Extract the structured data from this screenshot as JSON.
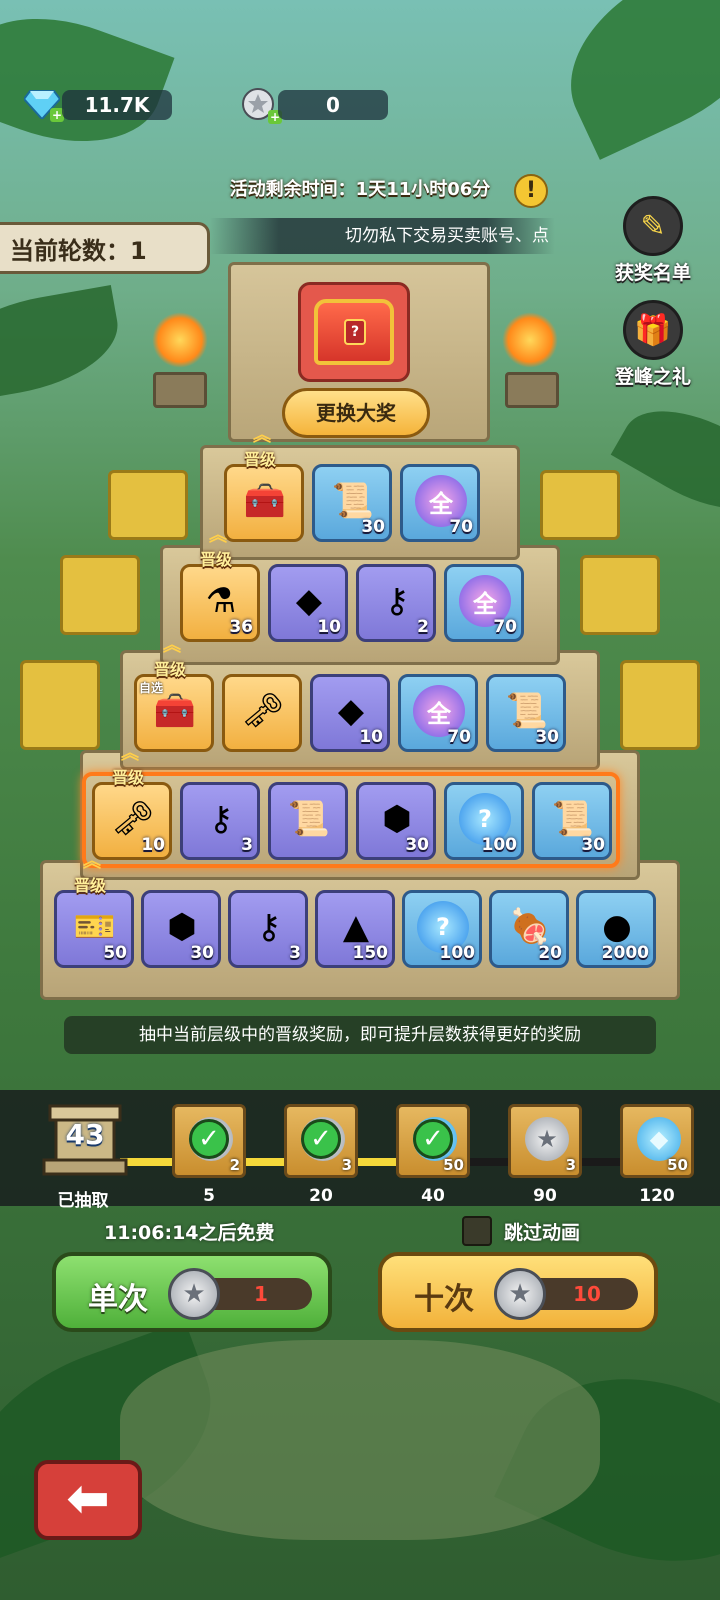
{
  "resources": {
    "gems": "11.7K",
    "tickets": "0"
  },
  "event": {
    "timer": "活动剩余时间：1天11小时06分",
    "round": "当前轮数：1",
    "notice": "切勿私下交易买卖账号、点"
  },
  "side": {
    "winners": "获奖名单",
    "peak_gift": "登峰之礼"
  },
  "grand": {
    "swap_label": "更换大奖"
  },
  "promo_label": "晋级",
  "self_select_label": "自选",
  "tiers": [
    {
      "items": [
        {
          "icon": "chest-icon",
          "count": ""
        },
        {
          "icon": "scroll-icon",
          "count": "30"
        },
        {
          "icon": "all-orb-icon",
          "count": "70"
        }
      ]
    },
    {
      "items": [
        {
          "icon": "potion-icon",
          "count": "36"
        },
        {
          "icon": "crystal-icon",
          "count": "10"
        },
        {
          "icon": "silver-key-icon",
          "count": "2"
        },
        {
          "icon": "all-orb-icon",
          "count": "70"
        }
      ]
    },
    {
      "items": [
        {
          "icon": "chest-icon",
          "count": ""
        },
        {
          "icon": "gold-key-icon",
          "count": ""
        },
        {
          "icon": "crystal-icon",
          "count": "10"
        },
        {
          "icon": "all-orb-icon",
          "count": "70"
        },
        {
          "icon": "scroll-icon",
          "count": "30"
        }
      ]
    },
    {
      "items": [
        {
          "icon": "gold-key-icon",
          "count": "10"
        },
        {
          "icon": "silver-key-icon",
          "count": "3"
        },
        {
          "icon": "purple-scroll-icon",
          "count": ""
        },
        {
          "icon": "ore-icon",
          "count": "30"
        },
        {
          "icon": "mystery-orb-icon",
          "count": "100"
        },
        {
          "icon": "scroll-icon",
          "count": "30"
        }
      ]
    },
    {
      "items": [
        {
          "icon": "ticket-icon",
          "count": "50"
        },
        {
          "icon": "ore-icon",
          "count": "30"
        },
        {
          "icon": "silver-key-icon",
          "count": "3"
        },
        {
          "icon": "dust-icon",
          "count": "150"
        },
        {
          "icon": "mystery-orb-icon",
          "count": "100"
        },
        {
          "icon": "meat-icon",
          "count": "20"
        },
        {
          "icon": "gold-coin-icon",
          "count": "2000"
        }
      ]
    }
  ],
  "hint": "抽中当前层级中的晋级奖励，即可提升层数获得更好的奖励",
  "progress": {
    "drawn": "43",
    "drawn_label": "已抽取",
    "milestones": [
      {
        "threshold": "5",
        "reward_count": "2",
        "claimed": true
      },
      {
        "threshold": "20",
        "reward_count": "3",
        "claimed": true
      },
      {
        "threshold": "40",
        "reward_count": "50",
        "claimed": true
      },
      {
        "threshold": "90",
        "reward_count": "3",
        "claimed": false
      },
      {
        "threshold": "120",
        "reward_count": "50",
        "claimed": false
      }
    ]
  },
  "draw": {
    "free_timer": "11:06:14之后免费",
    "skip_label": "跳过动画",
    "single_label": "单次",
    "single_cost": "1",
    "ten_label": "十次",
    "ten_cost": "10"
  },
  "colors": {
    "highlight": "#ff7a1a",
    "cost": "#ff4a3a"
  }
}
